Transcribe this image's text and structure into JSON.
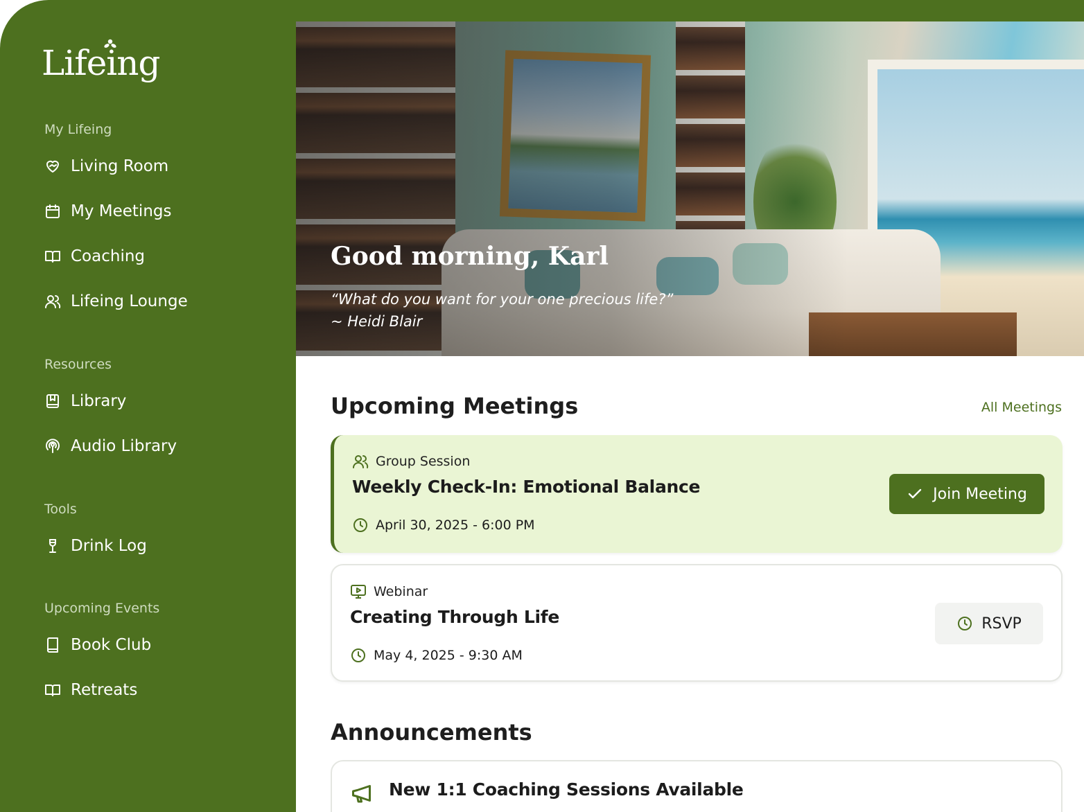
{
  "brand": {
    "name": "Lifeing"
  },
  "colors": {
    "brand_green": "#4d701f",
    "highlight_card": "#eaf5d4",
    "rsvp_bg": "#f2f3f1"
  },
  "sidebar": {
    "sections": [
      {
        "label": "My Lifeing",
        "items": [
          {
            "label": "Living Room",
            "icon": "heart-hands-icon"
          },
          {
            "label": "My Meetings",
            "icon": "calendar-icon"
          },
          {
            "label": "Coaching",
            "icon": "open-book-icon"
          },
          {
            "label": "Lifeing Lounge",
            "icon": "users-icon"
          }
        ]
      },
      {
        "label": "Resources",
        "items": [
          {
            "label": "Library",
            "icon": "bookmark-book-icon"
          },
          {
            "label": "Audio Library",
            "icon": "podcast-icon"
          }
        ]
      },
      {
        "label": "Tools",
        "items": [
          {
            "label": "Drink Log",
            "icon": "wine-glass-icon"
          }
        ]
      },
      {
        "label": "Upcoming Events",
        "items": [
          {
            "label": "Book Club",
            "icon": "book-icon"
          },
          {
            "label": "Retreats",
            "icon": "open-book-icon"
          }
        ]
      }
    ]
  },
  "hero": {
    "greeting": "Good morning, Karl",
    "quote": "“What do you want for your one precious life?”",
    "author": "~ Heidi Blair"
  },
  "meetings": {
    "title": "Upcoming Meetings",
    "all_link": "All Meetings",
    "items": [
      {
        "kind": "Group Session",
        "title": "Weekly Check-In: Emotional Balance",
        "when": "April 30, 2025 - 6:00 PM",
        "action": "Join Meeting"
      },
      {
        "kind": "Webinar",
        "title": "Creating Through Life",
        "when": "May 4, 2025 - 9:30 AM",
        "action": "RSVP"
      }
    ]
  },
  "announcements": {
    "title": "Announcements",
    "items": [
      {
        "title": "New 1:1 Coaching Sessions Available"
      }
    ]
  }
}
